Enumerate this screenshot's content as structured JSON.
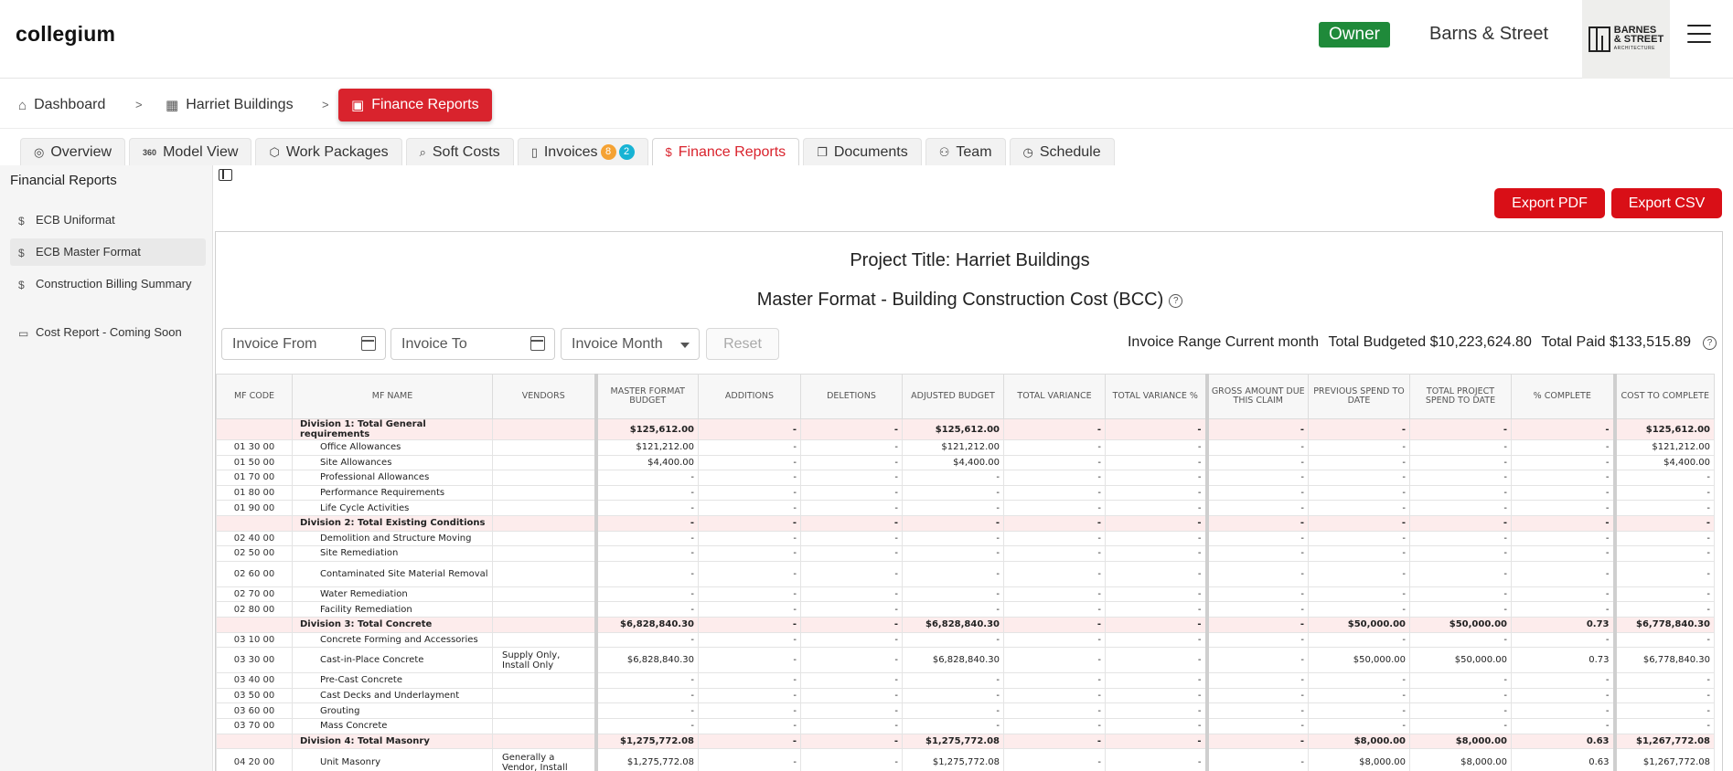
{
  "app": {
    "brand": "collegium",
    "role": "Owner",
    "org": "Barns & Street",
    "logo_line1": "BARNES",
    "logo_line2": "& STREET",
    "logo_line3": "ARCHITECTURE"
  },
  "breadcrumb": [
    {
      "label": "Dashboard",
      "icon": "home-icon"
    },
    {
      "label": "Harriet Buildings",
      "icon": "building-icon"
    },
    {
      "label": "Finance Reports",
      "icon": "clipboard-dollar-icon",
      "active": true
    }
  ],
  "tabs": [
    {
      "label": "Overview",
      "icon": "overview-icon"
    },
    {
      "label": "Model View",
      "icon": "360-icon"
    },
    {
      "label": "Work Packages",
      "icon": "package-icon"
    },
    {
      "label": "Soft Costs",
      "icon": "search-dollar-icon"
    },
    {
      "label": "Invoices",
      "icon": "document-icon",
      "badges": [
        "8",
        "2"
      ]
    },
    {
      "label": "Finance Reports",
      "icon": "dollar-icon",
      "active": true
    },
    {
      "label": "Documents",
      "icon": "documents-icon"
    },
    {
      "label": "Team",
      "icon": "team-icon"
    },
    {
      "label": "Schedule",
      "icon": "schedule-icon"
    }
  ],
  "sidebar": {
    "title": "Financial Reports",
    "items": [
      {
        "label": "ECB Uniformat",
        "icon": "dollar-icon"
      },
      {
        "label": "ECB Master Format",
        "icon": "dollar-icon",
        "active": true
      },
      {
        "label": "Construction Billing Summary",
        "icon": "dollar-icon"
      },
      {
        "label": "Cost Report - Coming Soon",
        "icon": "money-icon"
      }
    ]
  },
  "actions": {
    "export_pdf": "Export PDF",
    "export_csv": "Export CSV"
  },
  "report": {
    "project_title": "Project Title: Harriet Buildings",
    "subtitle": "Master Format - Building Construction Cost (BCC)",
    "filters": {
      "invoice_from": "Invoice From",
      "invoice_to": "Invoice To",
      "invoice_month": "Invoice Month",
      "reset": "Reset"
    },
    "totals": {
      "range": "Invoice Range Current month",
      "budgeted": "Total Budgeted $10,223,624.80",
      "paid": "Total Paid $133,515.89"
    },
    "columns": [
      "MF Code",
      "MF Name",
      "Vendors",
      "Master Format Budget",
      "Additions",
      "Deletions",
      "Adjusted Budget",
      "Total Variance",
      "Total Variance %",
      "Gross Amount Due This Claim",
      "Previous Spend to Date",
      "Total Project Spend to Date",
      "% Complete",
      "Cost to Complete"
    ],
    "rows": [
      {
        "type": "div",
        "cells": [
          "",
          "Division 1: Total General requirements",
          "",
          "$125,612.00",
          "-",
          "-",
          "$125,612.00",
          "-",
          "-",
          "-",
          "-",
          "-",
          "-",
          "$125,612.00"
        ]
      },
      {
        "type": "item",
        "cells": [
          "01 30 00",
          "Office Allowances",
          "",
          "$121,212.00",
          "-",
          "-",
          "$121,212.00",
          "-",
          "-",
          "-",
          "-",
          "-",
          "-",
          "$121,212.00"
        ]
      },
      {
        "type": "item",
        "cells": [
          "01 50 00",
          "Site Allowances",
          "",
          "$4,400.00",
          "-",
          "-",
          "$4,400.00",
          "-",
          "-",
          "-",
          "-",
          "-",
          "-",
          "$4,400.00"
        ]
      },
      {
        "type": "item",
        "cells": [
          "01 70 00",
          "Professional Allowances",
          "",
          "-",
          "-",
          "-",
          "-",
          "-",
          "-",
          "-",
          "-",
          "-",
          "-",
          "-"
        ]
      },
      {
        "type": "item",
        "cells": [
          "01 80 00",
          "Performance Requirements",
          "",
          "-",
          "-",
          "-",
          "-",
          "-",
          "-",
          "-",
          "-",
          "-",
          "-",
          "-"
        ]
      },
      {
        "type": "item",
        "cells": [
          "01 90 00",
          "Life Cycle Activities",
          "",
          "-",
          "-",
          "-",
          "-",
          "-",
          "-",
          "-",
          "-",
          "-",
          "-",
          "-"
        ]
      },
      {
        "type": "div",
        "cells": [
          "",
          "Division 2: Total Existing Conditions",
          "",
          "-",
          "-",
          "-",
          "-",
          "-",
          "-",
          "-",
          "-",
          "-",
          "-",
          "-"
        ]
      },
      {
        "type": "item",
        "cells": [
          "02 40 00",
          "Demolition and Structure Moving",
          "",
          "-",
          "-",
          "-",
          "-",
          "-",
          "-",
          "-",
          "-",
          "-",
          "-",
          "-"
        ]
      },
      {
        "type": "item",
        "cells": [
          "02 50 00",
          "Site Remediation",
          "",
          "-",
          "-",
          "-",
          "-",
          "-",
          "-",
          "-",
          "-",
          "-",
          "-",
          "-"
        ]
      },
      {
        "type": "item",
        "cells": [
          "02 60 00",
          "Contaminated Site Material Removal",
          "",
          "-",
          "-",
          "-",
          "-",
          "-",
          "-",
          "-",
          "-",
          "-",
          "-",
          "-"
        ]
      },
      {
        "type": "item",
        "cells": [
          "02 70 00",
          "Water Remediation",
          "",
          "-",
          "-",
          "-",
          "-",
          "-",
          "-",
          "-",
          "-",
          "-",
          "-",
          "-"
        ]
      },
      {
        "type": "item",
        "cells": [
          "02 80 00",
          "Facility Remediation",
          "",
          "-",
          "-",
          "-",
          "-",
          "-",
          "-",
          "-",
          "-",
          "-",
          "-",
          "-"
        ]
      },
      {
        "type": "div",
        "cells": [
          "",
          "Division 3: Total Concrete",
          "",
          "$6,828,840.30",
          "-",
          "-",
          "$6,828,840.30",
          "-",
          "-",
          "-",
          "$50,000.00",
          "$50,000.00",
          "0.73",
          "$6,778,840.30"
        ]
      },
      {
        "type": "item",
        "cells": [
          "03 10 00",
          "Concrete Forming and Accessories",
          "",
          "-",
          "-",
          "-",
          "-",
          "-",
          "-",
          "-",
          "-",
          "-",
          "-",
          "-"
        ]
      },
      {
        "type": "item",
        "cells": [
          "03 30 00",
          "Cast-in-Place Concrete",
          "Supply Only, Install Only",
          "$6,828,840.30",
          "-",
          "-",
          "$6,828,840.30",
          "-",
          "-",
          "-",
          "$50,000.00",
          "$50,000.00",
          "0.73",
          "$6,778,840.30"
        ]
      },
      {
        "type": "item",
        "cells": [
          "03 40 00",
          "Pre-Cast Concrete",
          "",
          "-",
          "-",
          "-",
          "-",
          "-",
          "-",
          "-",
          "-",
          "-",
          "-",
          "-"
        ]
      },
      {
        "type": "item",
        "cells": [
          "03 50 00",
          "Cast Decks and Underlayment",
          "",
          "-",
          "-",
          "-",
          "-",
          "-",
          "-",
          "-",
          "-",
          "-",
          "-",
          "-"
        ]
      },
      {
        "type": "item",
        "cells": [
          "03 60 00",
          "Grouting",
          "",
          "-",
          "-",
          "-",
          "-",
          "-",
          "-",
          "-",
          "-",
          "-",
          "-",
          "-"
        ]
      },
      {
        "type": "item",
        "cells": [
          "03 70 00",
          "Mass Concrete",
          "",
          "-",
          "-",
          "-",
          "-",
          "-",
          "-",
          "-",
          "-",
          "-",
          "-",
          "-"
        ]
      },
      {
        "type": "div",
        "cells": [
          "",
          "Division 4: Total Masonry",
          "",
          "$1,275,772.08",
          "-",
          "-",
          "$1,275,772.08",
          "-",
          "-",
          "-",
          "$8,000.00",
          "$8,000.00",
          "0.63",
          "$1,267,772.08"
        ]
      },
      {
        "type": "item",
        "cells": [
          "04 20 00",
          "Unit Masonry",
          "Generally a Vendor, Install",
          "$1,275,772.08",
          "-",
          "-",
          "$1,275,772.08",
          "-",
          "-",
          "-",
          "$8,000.00",
          "$8,000.00",
          "0.63",
          "$1,267,772.08"
        ]
      }
    ]
  }
}
